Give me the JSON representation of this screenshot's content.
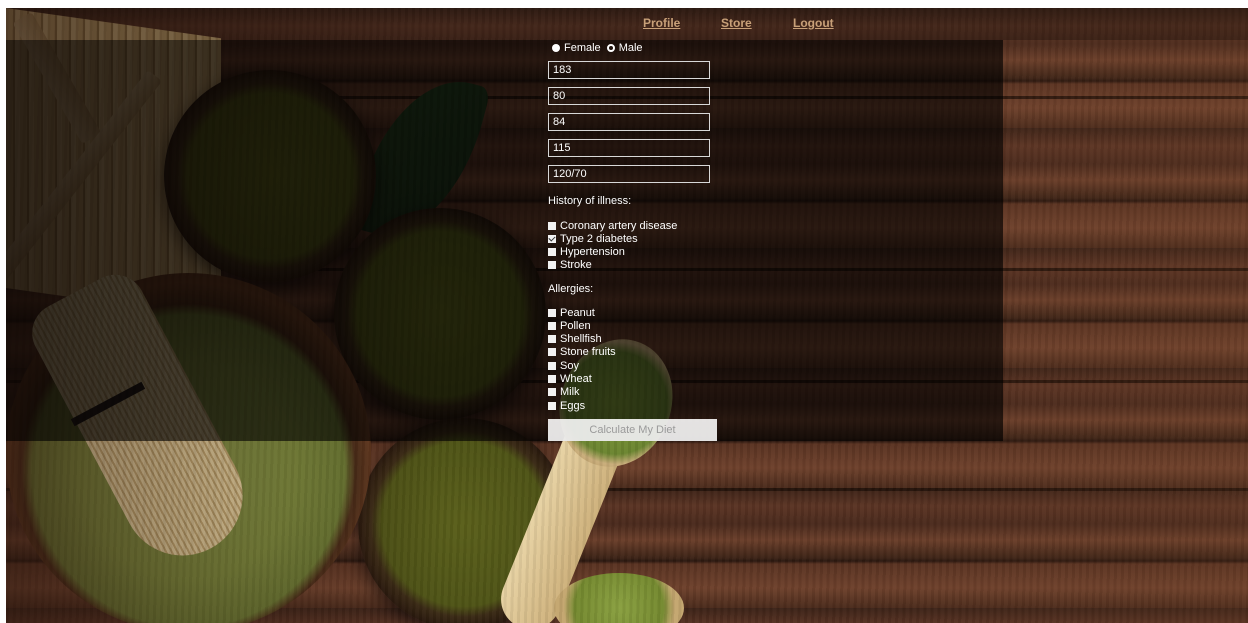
{
  "nav": {
    "profile": "Profile",
    "store": "Store",
    "logout": "Logout",
    "link_color": "#c8a078"
  },
  "gender": {
    "options": [
      "Female",
      "Male"
    ],
    "selected": "Female"
  },
  "fields": {
    "height": "183",
    "weight": "80",
    "field3": "84",
    "field4": "115",
    "blood_pressure": "120/70"
  },
  "history": {
    "title": "History of illness:",
    "items": [
      {
        "label": "Coronary artery disease",
        "checked": false
      },
      {
        "label": "Type 2 diabetes",
        "checked": true
      },
      {
        "label": "Hypertension",
        "checked": false
      },
      {
        "label": "Stroke",
        "checked": false
      }
    ]
  },
  "allergies": {
    "title": "Allergies:",
    "items": [
      {
        "label": "Peanut",
        "checked": false
      },
      {
        "label": "Pollen",
        "checked": false
      },
      {
        "label": "Shellfish",
        "checked": false
      },
      {
        "label": "Stone fruits",
        "checked": false
      },
      {
        "label": "Soy",
        "checked": false
      },
      {
        "label": "Wheat",
        "checked": false
      },
      {
        "label": "Milk",
        "checked": false
      },
      {
        "label": "Eggs",
        "checked": false
      }
    ]
  },
  "submit_label": "Calculate My Diet"
}
